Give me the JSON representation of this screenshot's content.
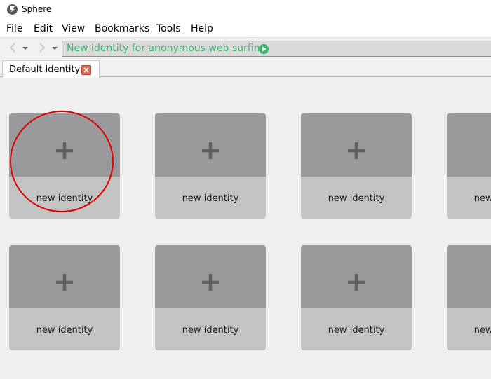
{
  "window": {
    "title": "Sphere"
  },
  "menu": {
    "items": [
      "File",
      "Edit",
      "View",
      "Bookmarks",
      "Tools",
      "Help"
    ]
  },
  "address": {
    "text": "New identity for anonymous web surfing"
  },
  "tabs": [
    {
      "label": "Default identity"
    }
  ],
  "cards": {
    "label": "new identity"
  },
  "colors": {
    "accent_green": "#3cb371",
    "card_top": "#9a999b",
    "card_bottom": "#c3c3c3",
    "tab_close": "#e06a4e",
    "highlight": "#e00000"
  }
}
